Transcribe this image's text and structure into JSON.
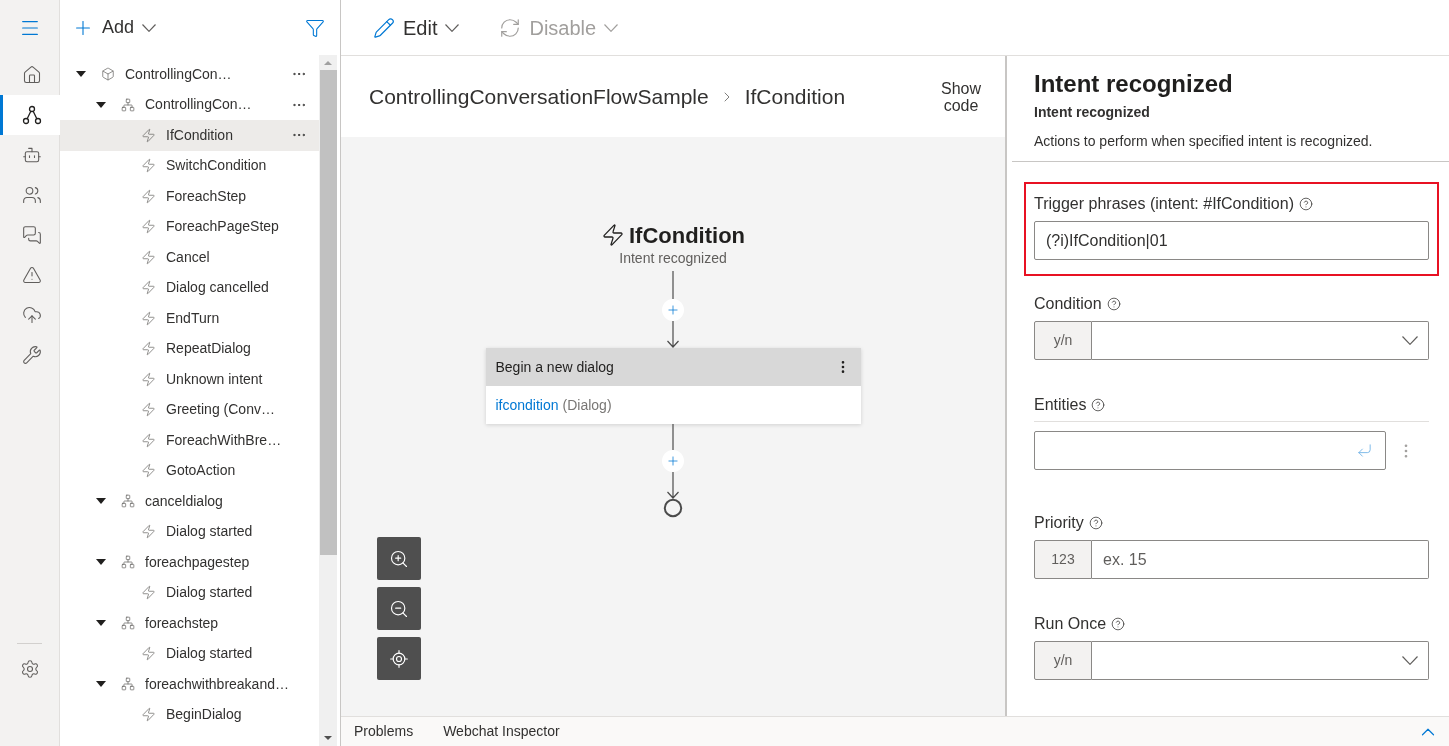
{
  "nav_rail": {
    "items": [
      {
        "kind": "home",
        "selected": false
      },
      {
        "kind": "design",
        "selected": true
      },
      {
        "kind": "bot",
        "selected": false
      },
      {
        "kind": "users",
        "selected": false
      },
      {
        "kind": "chat",
        "selected": false
      },
      {
        "kind": "warning",
        "selected": false
      },
      {
        "kind": "publish",
        "selected": false
      },
      {
        "kind": "tools",
        "selected": false
      }
    ]
  },
  "explorer": {
    "add_label": "Add",
    "tree": [
      {
        "kind": "bot",
        "label": "ControllingCon…",
        "expanded": true,
        "selected": false,
        "menu": true,
        "children": [
          {
            "kind": "dialog",
            "label": "ControllingCon…",
            "expanded": true,
            "selected": false,
            "menu": true,
            "children": [
              {
                "kind": "trigger",
                "label": "IfCondition",
                "selected": true,
                "menu": true
              },
              {
                "kind": "trigger",
                "label": "SwitchCondition",
                "selected": false,
                "menu": false
              },
              {
                "kind": "trigger",
                "label": "ForeachStep",
                "selected": false,
                "menu": false
              },
              {
                "kind": "trigger",
                "label": "ForeachPageStep",
                "selected": false,
                "menu": false
              },
              {
                "kind": "trigger",
                "label": "Cancel",
                "selected": false,
                "menu": false
              },
              {
                "kind": "trigger",
                "label": "Dialog cancelled",
                "selected": false,
                "menu": false
              },
              {
                "kind": "trigger",
                "label": "EndTurn",
                "selected": false,
                "menu": false
              },
              {
                "kind": "trigger",
                "label": "RepeatDialog",
                "selected": false,
                "menu": false
              },
              {
                "kind": "trigger",
                "label": "Unknown intent",
                "selected": false,
                "menu": false
              },
              {
                "kind": "trigger",
                "label": "Greeting (Conv…",
                "selected": false,
                "menu": false
              },
              {
                "kind": "trigger",
                "label": "ForeachWithBre…",
                "selected": false,
                "menu": false
              },
              {
                "kind": "trigger",
                "label": "GotoAction",
                "selected": false,
                "menu": false
              }
            ]
          },
          {
            "kind": "dialog",
            "label": "canceldialog",
            "expanded": true,
            "selected": false,
            "menu": false,
            "children": [
              {
                "kind": "trigger",
                "label": "Dialog started",
                "selected": false,
                "menu": false
              }
            ]
          },
          {
            "kind": "dialog",
            "label": "foreachpagestep",
            "expanded": true,
            "selected": false,
            "menu": false,
            "children": [
              {
                "kind": "trigger",
                "label": "Dialog started",
                "selected": false,
                "menu": false
              }
            ]
          },
          {
            "kind": "dialog",
            "label": "foreachstep",
            "expanded": true,
            "selected": false,
            "menu": false,
            "children": [
              {
                "kind": "trigger",
                "label": "Dialog started",
                "selected": false,
                "menu": false
              }
            ]
          },
          {
            "kind": "dialog",
            "label": "foreachwithbreakand…",
            "expanded": true,
            "selected": false,
            "menu": false,
            "children": [
              {
                "kind": "trigger",
                "label": "BeginDialog",
                "selected": false,
                "menu": false
              }
            ]
          }
        ]
      }
    ]
  },
  "toolbar": {
    "actions": [
      {
        "kind": "edit",
        "label": "Edit",
        "disabled": false
      },
      {
        "kind": "disable",
        "label": "Disable",
        "disabled": true
      }
    ]
  },
  "breadcrumb": [
    "ControllingConversationFlowSample",
    "IfCondition"
  ],
  "show_code": "Show code",
  "canvas": {
    "trigger": {
      "title": "IfCondition",
      "subtitle": "Intent recognized"
    },
    "action": {
      "header": "Begin a new dialog",
      "link": "ifcondition",
      "suffix": "(Dialog)"
    }
  },
  "bottom_tabs": [
    "Problems",
    "Webchat Inspector"
  ],
  "properties": {
    "title": "Intent recognized",
    "subtitle": "Intent recognized",
    "description": "Actions to perform when specified intent is recognized.",
    "fields": [
      {
        "kind": "text",
        "label": "Trigger phrases (intent: #IfCondition)",
        "value": "(?i)IfCondition|01",
        "highlighted": true
      },
      {
        "kind": "select",
        "label": "Condition",
        "prefix": "y/n",
        "highlighted": false
      },
      {
        "kind": "entities",
        "label": "Entities",
        "highlighted": false
      },
      {
        "kind": "number",
        "label": "Priority",
        "prefix": "123",
        "placeholder": "ex. 15",
        "highlighted": false
      },
      {
        "kind": "select",
        "label": "Run Once",
        "prefix": "y/n",
        "highlighted": false
      }
    ]
  }
}
